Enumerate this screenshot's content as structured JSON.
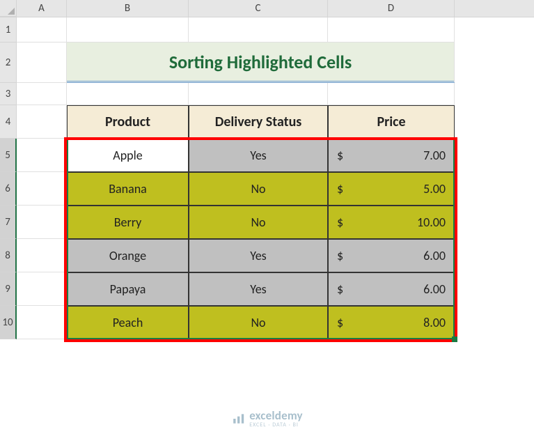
{
  "columns": {
    "A": "A",
    "B": "B",
    "C": "C",
    "D": "D"
  },
  "rows": {
    "r1": "1",
    "r2": "2",
    "r3": "3",
    "r4": "4",
    "r5": "5",
    "r6": "6",
    "r7": "7",
    "r8": "8",
    "r9": "9",
    "r10": "10"
  },
  "title": "Sorting Highlighted Cells",
  "headers": {
    "product": "Product",
    "status": "Delivery Status",
    "price": "Price"
  },
  "currency": "$",
  "rowsData": [
    {
      "product": "Apple",
      "status": "Yes",
      "price": "7.00",
      "highlight": "white"
    },
    {
      "product": "Banana",
      "status": "No",
      "price": "5.00",
      "highlight": "green"
    },
    {
      "product": "Berry",
      "status": "No",
      "price": "10.00",
      "highlight": "green"
    },
    {
      "product": "Orange",
      "status": "Yes",
      "price": "6.00",
      "highlight": "gray"
    },
    {
      "product": "Papaya",
      "status": "Yes",
      "price": "6.00",
      "highlight": "gray"
    },
    {
      "product": "Peach",
      "status": "No",
      "price": "8.00",
      "highlight": "green"
    }
  ],
  "watermark": {
    "brand": "exceldemy",
    "sub": "EXCEL · DATA · BI"
  }
}
